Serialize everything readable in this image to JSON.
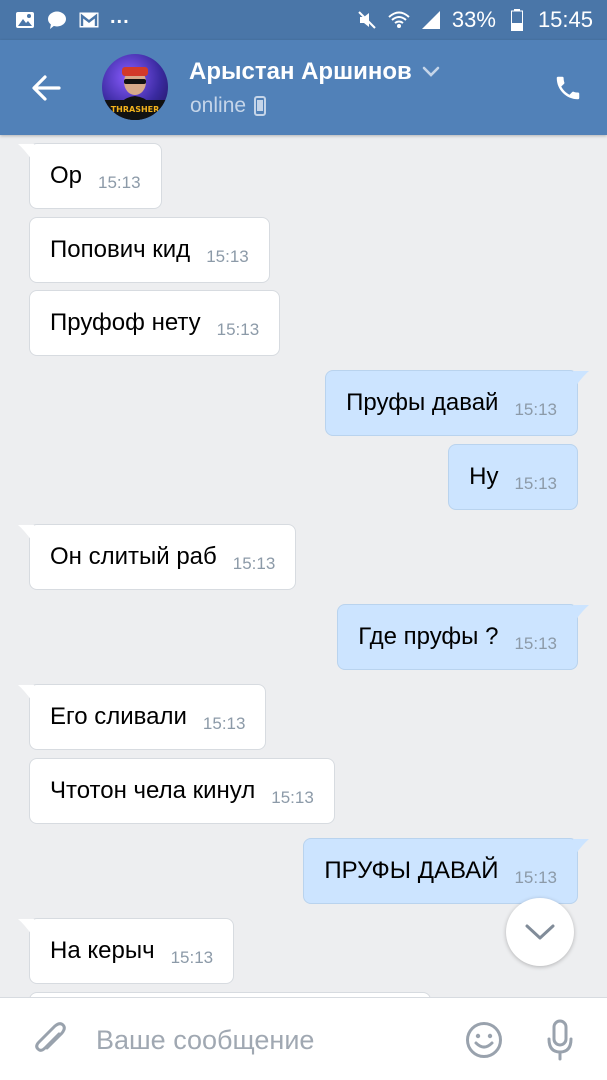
{
  "status_bar": {
    "left_icons": [
      "gallery-icon",
      "chat-icon",
      "gmail-icon"
    ],
    "more": "...",
    "battery": "33%",
    "time": "15:45",
    "right_icons": [
      "mute-icon",
      "wifi-icon",
      "signal-icon",
      "battery-icon"
    ]
  },
  "header": {
    "contact_name": "Арыстан Аршинов",
    "status": "online",
    "avatar_icon": "avatar-thrasher-photo",
    "colors": {
      "bar": "#5181b8",
      "status_bar": "#4a76a8"
    }
  },
  "messages": [
    {
      "dir": "in",
      "text": "Ор",
      "time": "15:13"
    },
    {
      "dir": "in",
      "text": "Попович кид",
      "time": "15:13"
    },
    {
      "dir": "in",
      "text": "Пруфоф нету",
      "time": "15:13"
    },
    {
      "dir": "out",
      "text": "Пруфы давай",
      "time": "15:13"
    },
    {
      "dir": "out",
      "text": "Ну",
      "time": "15:13"
    },
    {
      "dir": "in",
      "text": "Он слитый раб",
      "time": "15:13"
    },
    {
      "dir": "out",
      "text": "Где пруфы ?",
      "time": "15:13"
    },
    {
      "dir": "in",
      "text": "Его сливали",
      "time": "15:13"
    },
    {
      "dir": "in",
      "text": "Чтотон чела кинул",
      "time": "15:13"
    },
    {
      "dir": "out",
      "text": "ПРУФЫ ДАВАЙ",
      "time": "15:13"
    },
    {
      "dir": "in",
      "text": "На керыч",
      "time": "15:13"
    }
  ],
  "composer": {
    "placeholder": "Ваше сообщение"
  },
  "colors": {
    "incoming_bubble": "#ffffff",
    "outgoing_bubble": "#cce4ff",
    "background": "#edeef0",
    "time_text": "#8c9aa8"
  }
}
